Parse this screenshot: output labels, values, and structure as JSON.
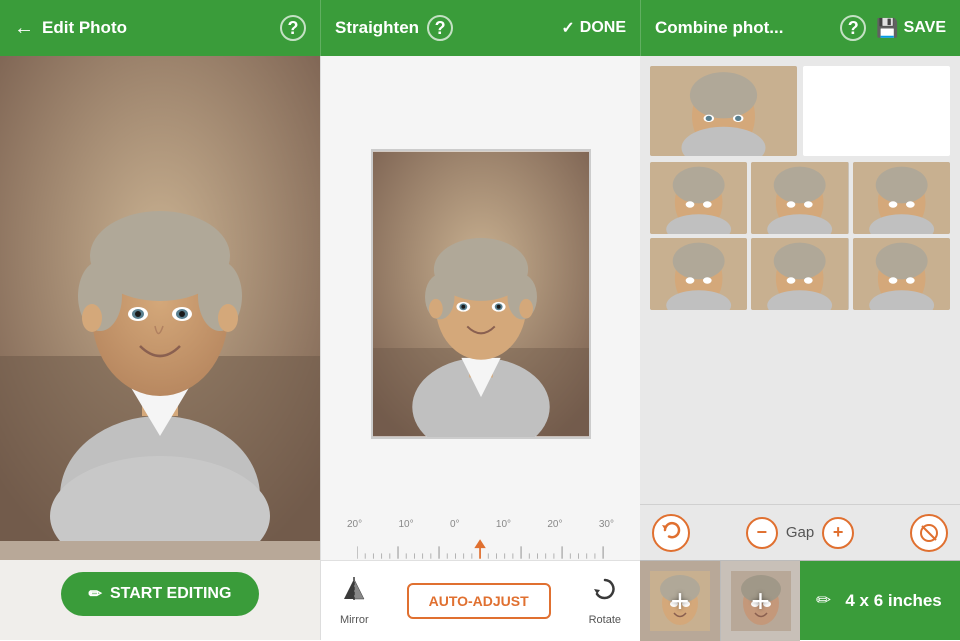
{
  "panels": {
    "left": {
      "title": "Edit Photo",
      "help_label": "?",
      "back_icon": "←",
      "start_editing_label": "START EDITING"
    },
    "middle": {
      "title": "Straighten",
      "help_label": "?",
      "done_label": "DONE",
      "ruler": {
        "labels": [
          "20°",
          "10°",
          "0°",
          "10°",
          "20°",
          "30°"
        ]
      },
      "tools": {
        "mirror_label": "Mirror",
        "auto_adjust_label": "AUTO-ADJUST",
        "rotate_label": "Rotate"
      }
    },
    "right": {
      "title": "Combine phot...",
      "help_label": "?",
      "save_label": "SAVE",
      "gap_label": "Gap",
      "size_label": "4 x 6 inches"
    }
  }
}
